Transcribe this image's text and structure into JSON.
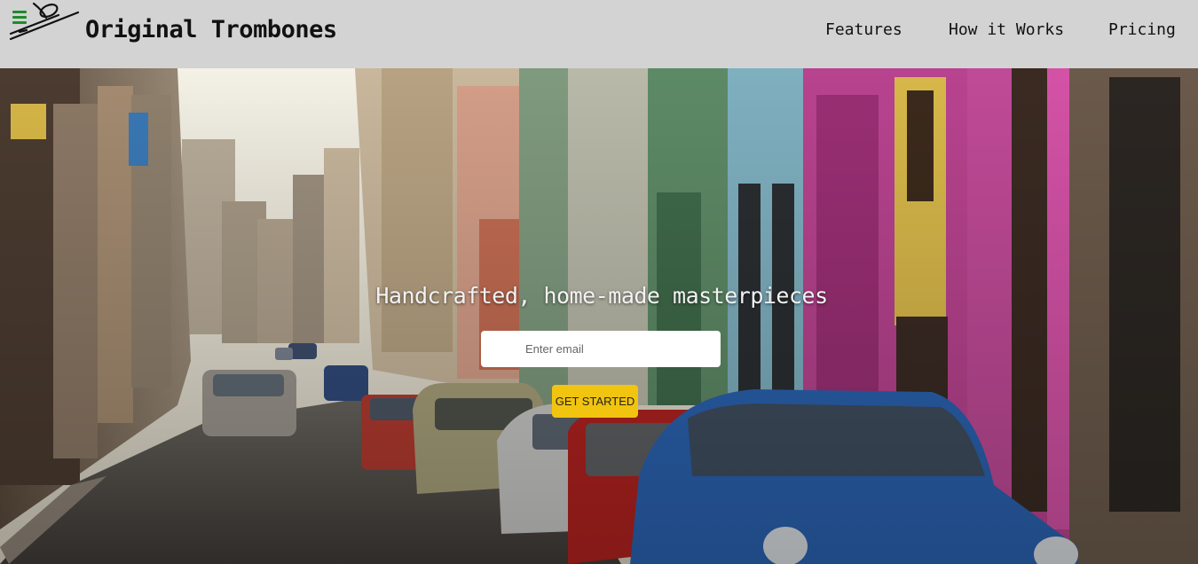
{
  "header": {
    "brand": "Original Trombones",
    "logo_icon": "trombone-icon",
    "nav": [
      {
        "label": "Features"
      },
      {
        "label": "How it Works"
      },
      {
        "label": "Pricing"
      }
    ]
  },
  "hero": {
    "background": "street-photo-havana-classic-cars",
    "tagline": "Handcrafted, home-made masterpieces",
    "email_placeholder": "Enter email",
    "cta_label": "GET STARTED"
  },
  "colors": {
    "header_bg": "#d3d3d3",
    "cta": "#f1c40f",
    "logo_green": "#1f8a2c"
  }
}
